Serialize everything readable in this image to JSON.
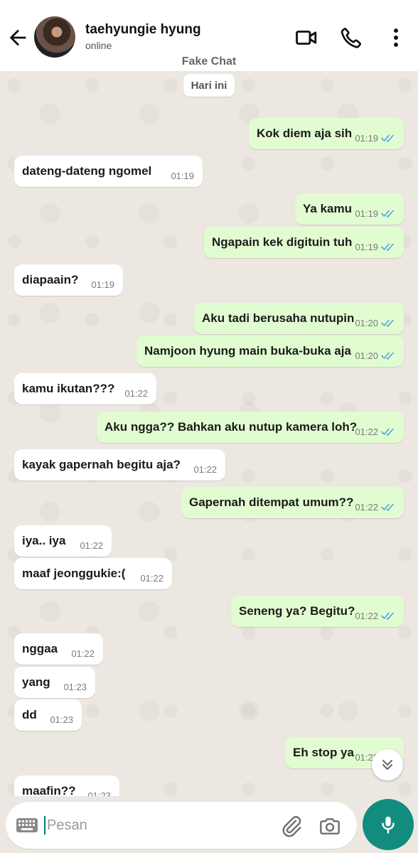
{
  "header": {
    "contact_name": "taehyungie hyung",
    "status": "online",
    "watermark": "Fake Chat"
  },
  "chat": {
    "date_label": "Hari ini",
    "messages": [
      {
        "dir": "out",
        "text": "Kok diem aja sih",
        "time": "01:19",
        "read": true
      },
      {
        "dir": "in",
        "text": "dateng-dateng ngomel",
        "time": "01:19"
      },
      {
        "dir": "out",
        "text": "Ya kamu",
        "time": "01:19",
        "read": true
      },
      {
        "dir": "out",
        "text": "Ngapain kek digituin tuh",
        "time": "01:19",
        "read": true
      },
      {
        "dir": "in",
        "text": "diapaain?",
        "time": "01:19"
      },
      {
        "dir": "out",
        "text": "Aku tadi berusaha nutupin",
        "time": "01:20",
        "read": true
      },
      {
        "dir": "out",
        "text": "Namjoon hyung main buka-buka aja",
        "time": "01:20",
        "read": true
      },
      {
        "dir": "in",
        "text": "kamu ikutan???",
        "time": "01:22"
      },
      {
        "dir": "out",
        "text": "Aku ngga?? Bahkan aku nutup kamera loh?",
        "time": "01:22",
        "read": true
      },
      {
        "dir": "in",
        "text": "kayak gapernah begitu aja?",
        "time": "01:22"
      },
      {
        "dir": "out",
        "text": "Gapernah ditempat umum??",
        "time": "01:22",
        "read": true
      },
      {
        "dir": "in",
        "text": "iya.. iya",
        "time": "01:22"
      },
      {
        "dir": "in",
        "text": "maaf jeonggukie:(",
        "time": "01:22"
      },
      {
        "dir": "out",
        "text": "Seneng ya? Begitu?",
        "time": "01:22",
        "read": true
      },
      {
        "dir": "in",
        "text": "nggaa",
        "time": "01:22"
      },
      {
        "dir": "in",
        "text": "yang",
        "time": "01:23"
      },
      {
        "dir": "in",
        "text": "dd",
        "time": "01:23"
      },
      {
        "dir": "out",
        "text": "Eh stop ya",
        "time": "01:23",
        "read": true
      },
      {
        "dir": "in",
        "text": "maafin??",
        "time": "01:23"
      }
    ]
  },
  "input": {
    "placeholder": "Pesan",
    "value": ""
  },
  "icons": {
    "back": "arrow-left-icon",
    "video": "video-call-icon",
    "call": "phone-icon",
    "menu": "more-vert-icon",
    "keyboard": "keyboard-icon",
    "attach": "paperclip-icon",
    "camera": "camera-icon",
    "mic": "mic-icon",
    "scroll": "chevrons-down-icon"
  },
  "colors": {
    "outgoing_bubble": "#e2fcd1",
    "incoming_bubble": "#ffffff",
    "read_ticks": "#4fa3e3",
    "accent": "#128c7e"
  }
}
